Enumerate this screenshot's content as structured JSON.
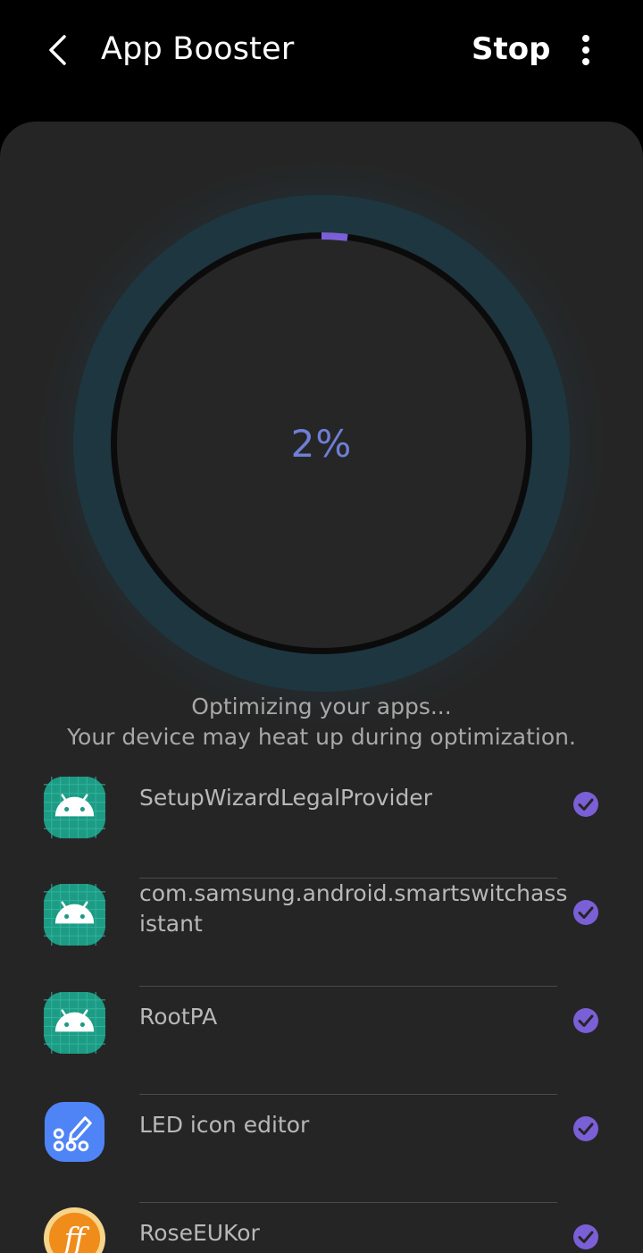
{
  "header": {
    "title": "App Booster",
    "stop_label": "Stop",
    "back_icon": "chevron-left-icon",
    "more_icon": "more-vertical-icon"
  },
  "progress": {
    "percent_text": "2%",
    "value": 0.02,
    "accent_color": "#7b5fd6",
    "ring_color": "#1e3640"
  },
  "status": {
    "line1": "Optimizing your apps...",
    "line2": "Your device may heat up during optimization."
  },
  "apps": [
    {
      "name": "SetupWizardLegalProvider",
      "icon": "android-icon",
      "done": true
    },
    {
      "name": "com.samsung.android.smartswitchassistant",
      "icon": "android-icon",
      "done": true
    },
    {
      "name": "RootPA",
      "icon": "android-icon",
      "done": true
    },
    {
      "name": "LED icon editor",
      "icon": "led-editor-icon",
      "done": true
    },
    {
      "name": "RoseEUKor",
      "icon": "font-ff-icon",
      "done": true
    }
  ]
}
